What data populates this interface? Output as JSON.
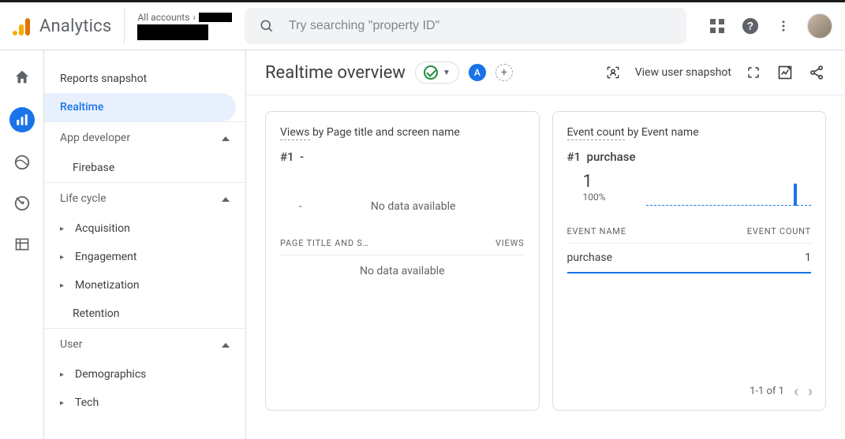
{
  "app": {
    "name": "Analytics",
    "account_prefix": "All accounts"
  },
  "search": {
    "placeholder": "Try searching \"property ID\""
  },
  "sidebar": {
    "snapshot": "Reports snapshot",
    "realtime": "Realtime",
    "section_app_dev": "App developer",
    "firebase": "Firebase",
    "section_lifecycle": "Life cycle",
    "acquisition": "Acquisition",
    "engagement": "Engagement",
    "monetization": "Monetization",
    "retention": "Retention",
    "section_user": "User",
    "demographics": "Demographics",
    "tech": "Tech"
  },
  "header": {
    "title": "Realtime overview",
    "badge_letter": "A",
    "snapshot_link": "View user snapshot"
  },
  "card_views": {
    "metric": "Views",
    "by": " by Page title and screen name",
    "rank": "#1",
    "rank_value": "-",
    "mid_nodata": "No data available",
    "col1": "PAGE TITLE AND S…",
    "col2": "VIEWS",
    "nodata": "No data available"
  },
  "card_events": {
    "metric": "Event count",
    "by": " by Event name",
    "rank": "#1",
    "rank_value": "purchase",
    "value": "1",
    "percent": "100%",
    "col1": "EVENT NAME",
    "col2": "EVENT COUNT",
    "row_name": "purchase",
    "row_value": "1",
    "pager": "1-1 of 1"
  }
}
